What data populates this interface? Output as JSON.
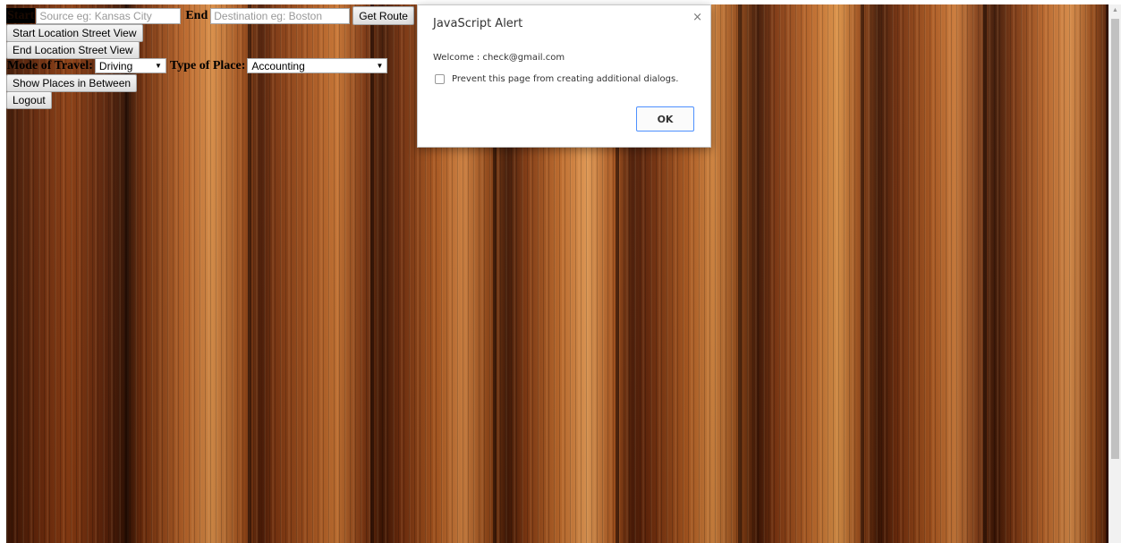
{
  "form": {
    "start_label": "Start",
    "start_placeholder": "Source eg: Kansas City",
    "end_label": "End",
    "end_placeholder": "Destination eg: Boston",
    "get_route_label": "Get Route",
    "start_street_view_label": "Start Location Street View",
    "end_street_view_label": "End Location Street View",
    "mode_label": "Mode of Travel:",
    "mode_value": "Driving",
    "place_type_label": "Type of Place:",
    "place_type_value": "Accounting",
    "show_places_label": "Show Places in Between",
    "logout_label": "Logout"
  },
  "dialog": {
    "title": "JavaScript Alert",
    "close_glyph": "×",
    "message": "Welcome : check@gmail.com",
    "checkbox_label": "Prevent this page from creating additional dialogs.",
    "ok_label": "OK"
  },
  "icons": {
    "close": "close-icon",
    "dropdown": "chevron-down-icon",
    "scroll_up": "arrow-up-icon"
  },
  "colors": {
    "ok_border": "#4d90fe",
    "wood_dark": "#3a1404",
    "wood_light": "#d88d48"
  }
}
